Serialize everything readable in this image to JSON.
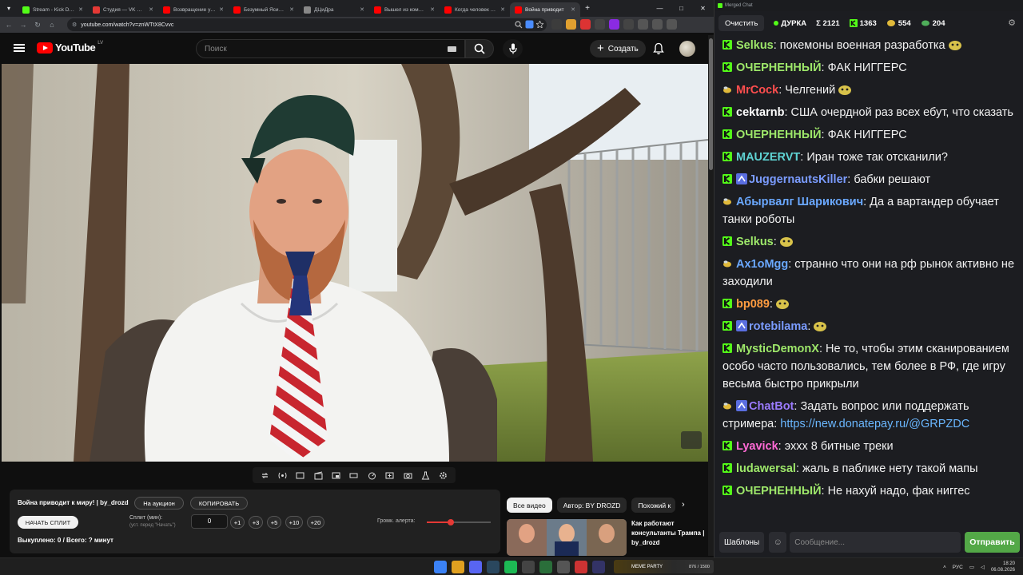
{
  "browser": {
    "tabs": [
      {
        "label": "Stream - Kick Dashboa",
        "color": "#53fc18"
      },
      {
        "label": "Студия — VK Видео |",
        "color": "#e53935"
      },
      {
        "label": "Возвращение укааш",
        "color": "#ff0000"
      },
      {
        "label": "Безумный Ясир Нико",
        "color": "#ff0000"
      },
      {
        "label": "ДЦиДра",
        "color": "#888888"
      },
      {
        "label": "Вышел из комы в 20",
        "color": "#ff0000"
      },
      {
        "label": "Когда человек поме",
        "color": "#ff0000"
      },
      {
        "label": "Война приводит",
        "color": "#ff0000"
      }
    ],
    "active_tab_index": 7,
    "url": "youtube.com/watch?v=znWTtX8Cvvc"
  },
  "youtube": {
    "logo_text": "YouTube",
    "country_code": "LV",
    "search_placeholder": "Поиск",
    "create_label": "Создать"
  },
  "panel": {
    "title": "Война приводит к миру! | by_drozd",
    "auction_label": "На аукцион",
    "copy_label": "КОПИРОВАТЬ",
    "start_split_label": "НАЧАТЬ СПЛИТ",
    "split_label": "Сплит (мин):",
    "split_hint": "(уст. перед \"Начать\")",
    "split_value": "0",
    "increments": [
      "+1",
      "+3",
      "+5",
      "+10",
      "+20"
    ],
    "alert_volume_label": "Громк. алерта:",
    "alert_volume_fraction": 0.38,
    "bought_label": "Выкуплено: 0 / Всего: ? минут"
  },
  "recommendations": {
    "chips": [
      "Все видео",
      "Автор: BY DROZD",
      "Похожий к"
    ],
    "first_title": "Как работают консультанты Трампа | by_drozd"
  },
  "chat": {
    "window_title": "Merged Chat",
    "clear_label": "Очистить",
    "channel": "ДУРКА",
    "stats": [
      {
        "icon": "sigma",
        "value": "Σ 2121"
      },
      {
        "icon": "kick-icon",
        "value": "1363"
      },
      {
        "icon": "coin-icon",
        "value": "554"
      },
      {
        "icon": "leaf-icon",
        "value": "204"
      }
    ],
    "messages": [
      {
        "platform": "kick",
        "user": "Selkus",
        "color": "#9ee86a",
        "text": " покемоны военная разработка",
        "emote": true
      },
      {
        "platform": "kick",
        "user": "ОЧЕРНЕННЫЙ",
        "color": "#9ee86a",
        "text": " ФАК НИГГЕРС"
      },
      {
        "platform": "twitch",
        "user": "MrCock",
        "color": "#ff4e4e",
        "text": " Челгений",
        "emote": true
      },
      {
        "platform": "kick",
        "user": "cektarnb",
        "color": "#ffffff",
        "text": " США очердной раз всех ебут, что сказать"
      },
      {
        "platform": "kick",
        "user": "ОЧЕРНЕННЫЙ",
        "color": "#9ee86a",
        "text": " ФАК НИГГЕРС"
      },
      {
        "platform": "kick",
        "user": "MAUZERVT",
        "color": "#5fd3d3",
        "text": " Иран тоже так отсканили?"
      },
      {
        "platform": "kick",
        "user": "JuggernautsKiller",
        "color": "#7b9cff",
        "text": " бабки решают",
        "badge": true
      },
      {
        "platform": "twitch",
        "user": "Абырвалг Шарикович",
        "color": "#6aa8ff",
        "text": " Да а вартандер обучает танки роботы"
      },
      {
        "platform": "kick",
        "user": "Selkus",
        "color": "#9ee86a",
        "text": "",
        "emote": true
      },
      {
        "platform": "twitch",
        "user": "Ax1oMgg",
        "color": "#6aa8ff",
        "text": " странно что они на рф рынок активно не заходили"
      },
      {
        "platform": "kick",
        "user": "bp089",
        "color": "#ff9c40",
        "text": "",
        "emote": true
      },
      {
        "platform": "kick",
        "user": "rotebilama",
        "color": "#7b9cff",
        "text": "",
        "emote": true,
        "badge": true
      },
      {
        "platform": "kick",
        "user": "MysticDemonX",
        "color": "#9ee86a",
        "text": " Не то, чтобы этим сканированием особо часто пользовались, тем более в РФ, где игру весьма быстро прикрыли"
      },
      {
        "platform": "twitch",
        "user": "ChatBot",
        "color": "#9b7bff",
        "text": " Задать вопрос или поддержать стримера: ",
        "link": "https://new.donatepay.ru/@GRPZDC",
        "badge": true
      },
      {
        "platform": "kick",
        "user": "Lyavick",
        "color": "#ff6ad5",
        "text": " эххх 8 битные треки"
      },
      {
        "platform": "kick",
        "user": "ludawersal",
        "color": "#9ee86a",
        "text": " жаль в паблике нету такой мапы"
      },
      {
        "platform": "kick",
        "user": "ОЧЕРНЕННЫЙ",
        "color": "#9ee86a",
        "text": " Не нахуй надо, фак ниггес"
      }
    ],
    "templates_label": "Шаблоны",
    "input_placeholder": "Сообщение...",
    "send_label": "Отправить"
  },
  "taskbar": {
    "banner_text": "MEME PARTY",
    "banner_count": "876 / 1500",
    "lang": "РУС",
    "time": "18:20",
    "date": "06.08.2026"
  },
  "colors": {
    "kick_green": "#53fc18",
    "yt_red": "#ff0000",
    "send_green": "#53a847"
  }
}
